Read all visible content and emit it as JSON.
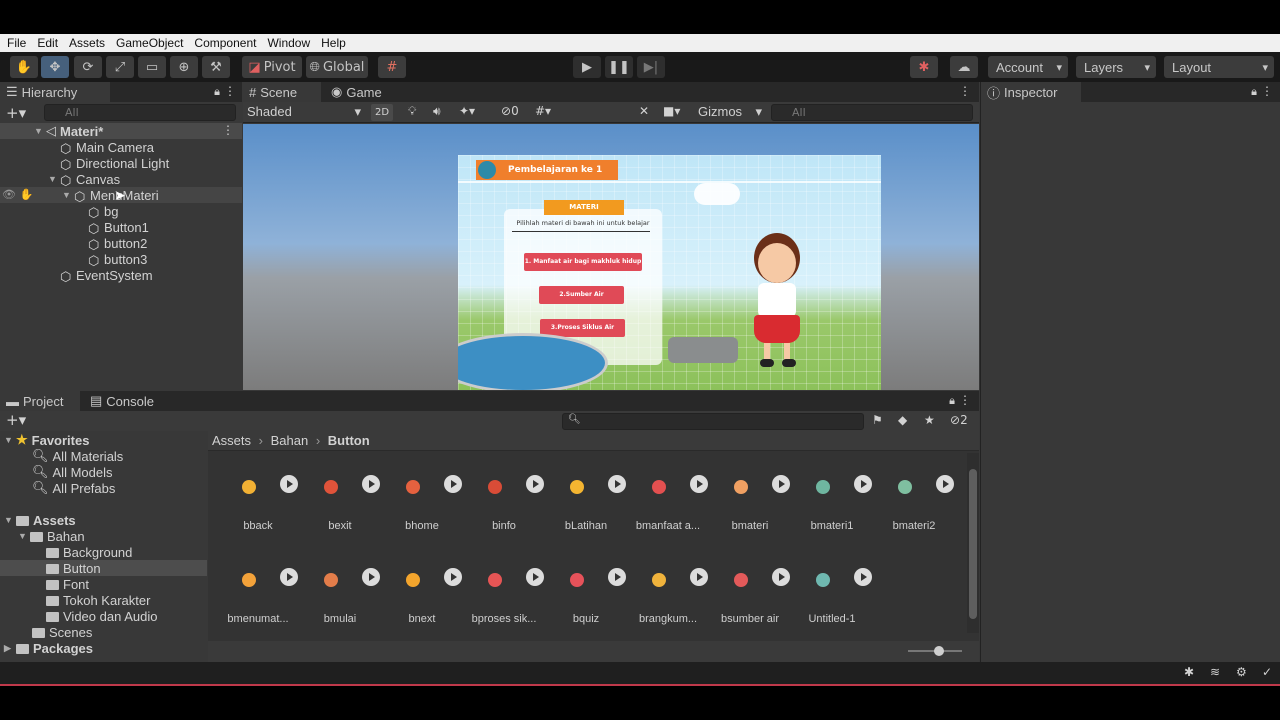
{
  "menu": [
    "File",
    "Edit",
    "Assets",
    "GameObject",
    "Component",
    "Window",
    "Help"
  ],
  "toolbar": {
    "pivot": "Pivot",
    "global": "Global",
    "account": "Account",
    "layers": "Layers",
    "layout": "Layout"
  },
  "hierarchy": {
    "tab": "Hierarchy",
    "search_placeholder": "All",
    "scene": "Materi*",
    "items": [
      "Main Camera",
      "Directional Light",
      "Canvas",
      "MenuMateri",
      "bg",
      "Button1",
      "button2",
      "button3",
      "EventSystem"
    ]
  },
  "scene_view": {
    "tabs": [
      "Scene",
      "Game"
    ],
    "shading": "Shaded",
    "mode_2d": "2D",
    "hidden_count": "0",
    "gizmos": "Gizmos",
    "search_placeholder": "All",
    "game": {
      "header": "Pembelajaran ke 1",
      "ribbon": "MATERI",
      "subtitle": "Pilihlah materi di bawah ini untuk belajar",
      "buttons": [
        "1. Manfaat air bagi makhluk hidup",
        "2.Sumber Air",
        "3.Proses Siklus Air"
      ]
    }
  },
  "inspector": {
    "tab": "Inspector"
  },
  "project": {
    "tabs": [
      "Project",
      "Console"
    ],
    "visibility_count": "2",
    "favorites_label": "Favorites",
    "favorites": [
      "All Materials",
      "All Models",
      "All Prefabs"
    ],
    "assets_label": "Assets",
    "bahan": "Bahan",
    "bahan_children": [
      "Background",
      "Button",
      "Font",
      "Tokoh Karakter",
      "Video dan Audio"
    ],
    "scenes": "Scenes",
    "packages": "Packages",
    "breadcrumb": [
      "Assets",
      "Bahan",
      "Button"
    ],
    "assets_row1": [
      "bback",
      "bexit",
      "bhome",
      "binfo",
      "bLatihan",
      "bmanfaat a...",
      "bmateri",
      "bmateri1",
      "bmateri2"
    ],
    "assets_row2": [
      "bmenumat...",
      "bmulai",
      "bnext",
      "bproses sik...",
      "bquiz",
      "brangkum...",
      "bsumber air",
      "Untitled-1"
    ],
    "thumb_colors_row1": [
      "#f2b134",
      "#e0533a",
      "#e5613f",
      "#d94c37",
      "#f4b531",
      "#e35050",
      "#f0a062",
      "#6fb6a0",
      "#7fbfa0"
    ],
    "thumb_colors_row2": [
      "#f3a23a",
      "#e37d4a",
      "#f3a52d",
      "#e65555",
      "#e6525a",
      "#f0b33c",
      "#e35a5a",
      "#6fb8b0"
    ]
  },
  "colors": {
    "accent": "#46607c",
    "selection": "#2c5d87",
    "panel": "#383838"
  }
}
